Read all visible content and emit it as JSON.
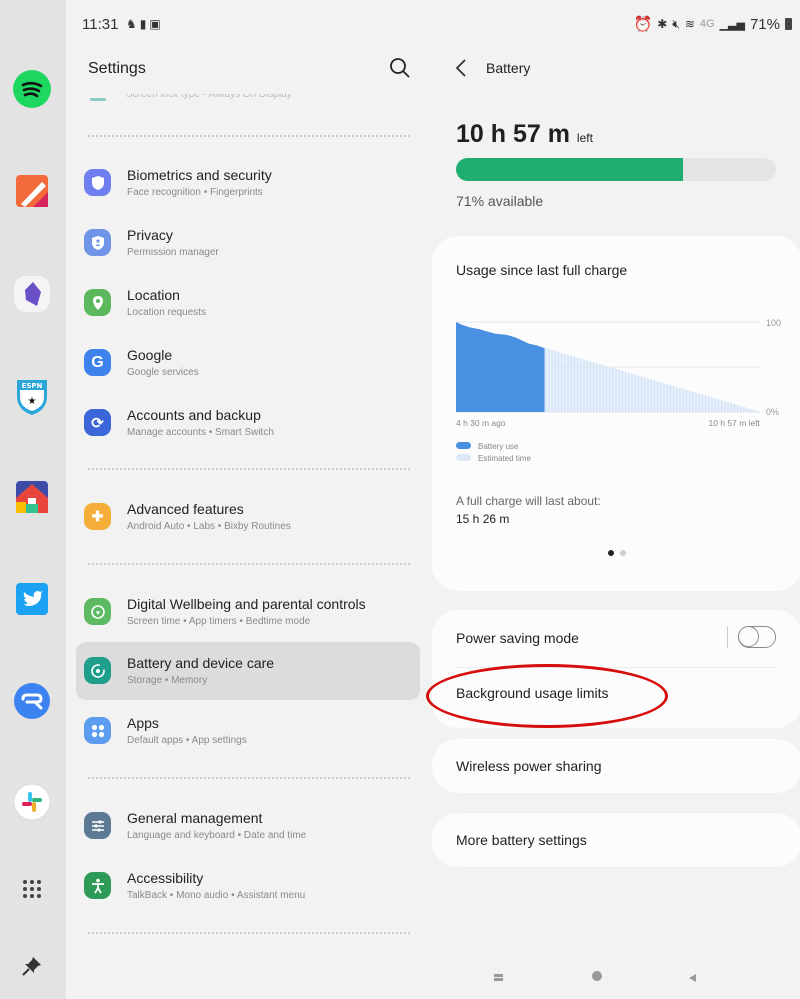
{
  "taskbar": {
    "apps": [
      {
        "name": "Spotify",
        "icon": "spotify-icon",
        "color": "#1ed760"
      },
      {
        "name": "Notes",
        "icon": "notes-icon",
        "color": "#f06a3c"
      },
      {
        "name": "Obsidian",
        "icon": "obsidian-icon",
        "color": "#6b4fc8"
      },
      {
        "name": "ESPN Fantasy",
        "icon": "espn-icon",
        "color": "#00a0e0"
      },
      {
        "name": "Google Home",
        "icon": "google-home-icon",
        "color": "#e8453c"
      },
      {
        "name": "Twitter",
        "icon": "twitter-icon",
        "color": "#1da1f2"
      },
      {
        "name": "Relay",
        "icon": "relay-icon",
        "color": "#3c82f0"
      },
      {
        "name": "Slack",
        "icon": "slack-icon",
        "color": "#ffffff"
      }
    ],
    "app_drawer_icon": "grid-icon",
    "pin_icon": "pin-icon"
  },
  "status_bar": {
    "time": "11:31",
    "network_label": "4G",
    "battery_percent": "71%"
  },
  "settings": {
    "title": "Settings",
    "search_icon": "search-icon",
    "partial_item_subtitle": "Screen lock type  •  Always On Display",
    "items": [
      {
        "title": "Biometrics and security",
        "subtitle": "Face recognition  •  Fingerprints",
        "icon": "shield-icon",
        "color": "#6f7ff0"
      },
      {
        "title": "Privacy",
        "subtitle": "Permission manager",
        "icon": "privacy-shield-icon",
        "color": "#6f94e8"
      },
      {
        "title": "Location",
        "subtitle": "Location requests",
        "icon": "location-pin-icon",
        "color": "#5cb85c"
      },
      {
        "title": "Google",
        "subtitle": "Google services",
        "icon": "google-g-icon",
        "color": "#3d82ed"
      },
      {
        "title": "Accounts and backup",
        "subtitle": "Manage accounts  •  Smart Switch",
        "icon": "sync-icon",
        "color": "#3b66d8"
      },
      {
        "title": "Advanced features",
        "subtitle": "Android Auto  •  Labs  •  Bixby Routines",
        "icon": "gear-plus-icon",
        "color": "#f5ae3a"
      },
      {
        "title": "Digital Wellbeing and parental controls",
        "subtitle": "Screen time  •  App timers  •  Bedtime mode",
        "icon": "wellbeing-heart-icon",
        "color": "#5dba63"
      },
      {
        "title": "Battery and device care",
        "subtitle": "Storage  •  Memory",
        "icon": "device-care-icon",
        "color": "#1e9f8c",
        "active": true
      },
      {
        "title": "Apps",
        "subtitle": "Default apps  •  App settings",
        "icon": "apps-grid-icon",
        "color": "#5d9df0"
      },
      {
        "title": "General management",
        "subtitle": "Language and keyboard  •  Date and time",
        "icon": "sliders-icon",
        "color": "#5d7a94"
      },
      {
        "title": "Accessibility",
        "subtitle": "TalkBack  •  Mono audio  •  Assistant menu",
        "icon": "accessibility-icon",
        "color": "#2e9a58"
      }
    ]
  },
  "battery": {
    "title": "Battery",
    "time_left": "10 h 57 m",
    "time_left_suffix": "left",
    "percent_available": 71,
    "available_label": "71% available",
    "bar_color": "#1fae6f",
    "usage_card": {
      "title": "Usage since last full charge",
      "full_charge_label": "A full charge will last about:",
      "full_charge_value": "15 h 26 m",
      "page_dots": 2,
      "active_dot": 0
    },
    "options": {
      "power_saving": "Power saving mode",
      "power_saving_on": false,
      "background_limits": "Background usage limits",
      "wireless_sharing": "Wireless power sharing",
      "more_settings": "More battery settings"
    }
  },
  "chart_data": {
    "type": "area",
    "title": "Usage since last full charge",
    "x_start_label": "4 h 30 m ago",
    "x_end_label": "10 h 57 m left",
    "y_tick_labels": [
      "100",
      "0%"
    ],
    "ylim": [
      0,
      100
    ],
    "x_range_hours": [
      -4.5,
      10.95
    ],
    "series": [
      {
        "name": "Battery use",
        "color": "#4a90e2",
        "x": [
          -4.5,
          -4.2,
          -3.8,
          -3.3,
          -3.0,
          -2.5,
          -2.0,
          -1.8,
          -1.5,
          -1.1,
          -0.8,
          -0.4,
          0
        ],
        "y": [
          100,
          97,
          94,
          92,
          90,
          87,
          86,
          85,
          83,
          79,
          76,
          74,
          71
        ]
      },
      {
        "name": "Estimated time",
        "color": "#d6e6f8",
        "x": [
          0,
          10.95
        ],
        "y": [
          71,
          0
        ]
      }
    ],
    "legend": [
      "Battery use",
      "Estimated time"
    ],
    "grid": true
  },
  "annotation": {
    "target": "Background usage limits",
    "color": "#d60d0d"
  },
  "nav_bar": {
    "recents_icon": "recents-icon",
    "home_icon": "home-icon",
    "back_icon": "back-triangle-icon"
  }
}
